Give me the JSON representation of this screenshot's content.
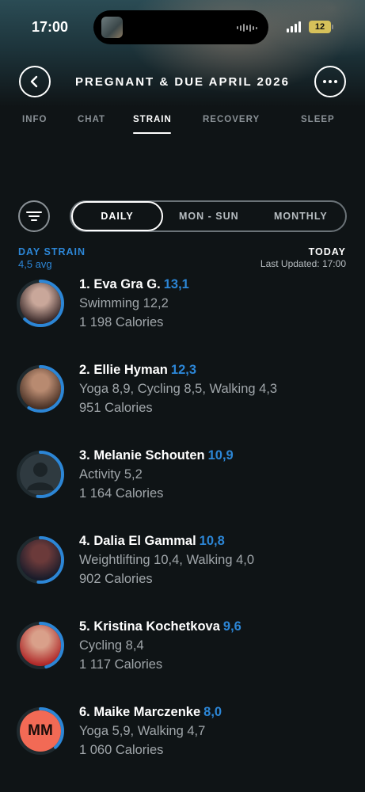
{
  "status_bar": {
    "time": "17:00",
    "battery": "12"
  },
  "header": {
    "title": "PREGNANT & DUE APRIL 2026"
  },
  "tabs": [
    {
      "label": "INFO"
    },
    {
      "label": "CHAT"
    },
    {
      "label": "STRAIN"
    },
    {
      "label": "RECOVERY"
    },
    {
      "label": "SLEEP"
    }
  ],
  "period_selector": {
    "options": [
      "DAILY",
      "MON - SUN",
      "MONTHLY"
    ],
    "selected": "DAILY"
  },
  "summary": {
    "day_strain_label": "DAY STRAIN",
    "avg": "4,5 avg",
    "today_label": "TODAY",
    "last_updated": "Last Updated: 17:00"
  },
  "leaderboard": [
    {
      "name": "1. Eva Gra G.",
      "score": "13,1",
      "score_value": 13.1,
      "activities": "Swimming 12,2",
      "calories": "1 198 Calories",
      "avatar_icon": "photo-avatar",
      "avatar_colors": [
        "#c9a79a",
        "#3a2a2a"
      ],
      "initials": ""
    },
    {
      "name": "2. Ellie Hyman",
      "score": "12,3",
      "score_value": 12.3,
      "activities": "Yoga 8,9, Cycling 8,5, Walking 4,3",
      "calories": "951 Calories",
      "avatar_icon": "photo-avatar",
      "avatar_colors": [
        "#b88a70",
        "#4a3226"
      ],
      "initials": ""
    },
    {
      "name": "3. Melanie Schouten",
      "score": "10,9",
      "score_value": 10.9,
      "activities": "Activity 5,2",
      "calories": "1 164 Calories",
      "avatar_icon": "person-placeholder-icon",
      "avatar_colors": [
        "#2f3a40",
        "#1c2428"
      ],
      "initials": ""
    },
    {
      "name": "4. Dalia El Gammal",
      "score": "10,8",
      "score_value": 10.8,
      "activities": "Weightlifting 10,4, Walking 4,0",
      "calories": "902 Calories",
      "avatar_icon": "photo-avatar",
      "avatar_colors": [
        "#6b3a3a",
        "#1a1c2a"
      ],
      "initials": ""
    },
    {
      "name": "5. Kristina Kochetkova",
      "score": "9,6",
      "score_value": 9.6,
      "activities": "Cycling 8,4",
      "calories": "1 117 Calories",
      "avatar_icon": "photo-avatar",
      "avatar_colors": [
        "#d9a08a",
        "#b02a2a"
      ],
      "initials": ""
    },
    {
      "name": "6. Maike Marczenke",
      "score": "8,0",
      "score_value": 8.0,
      "activities": "Yoga 5,9, Walking 4,7",
      "calories": "1 060 Calories",
      "avatar_icon": "initials-avatar",
      "avatar_colors": [
        "#f26a55",
        "#f26a55"
      ],
      "initials": "MM"
    }
  ],
  "strain_max": 21,
  "accent_color": "#2c86d6"
}
